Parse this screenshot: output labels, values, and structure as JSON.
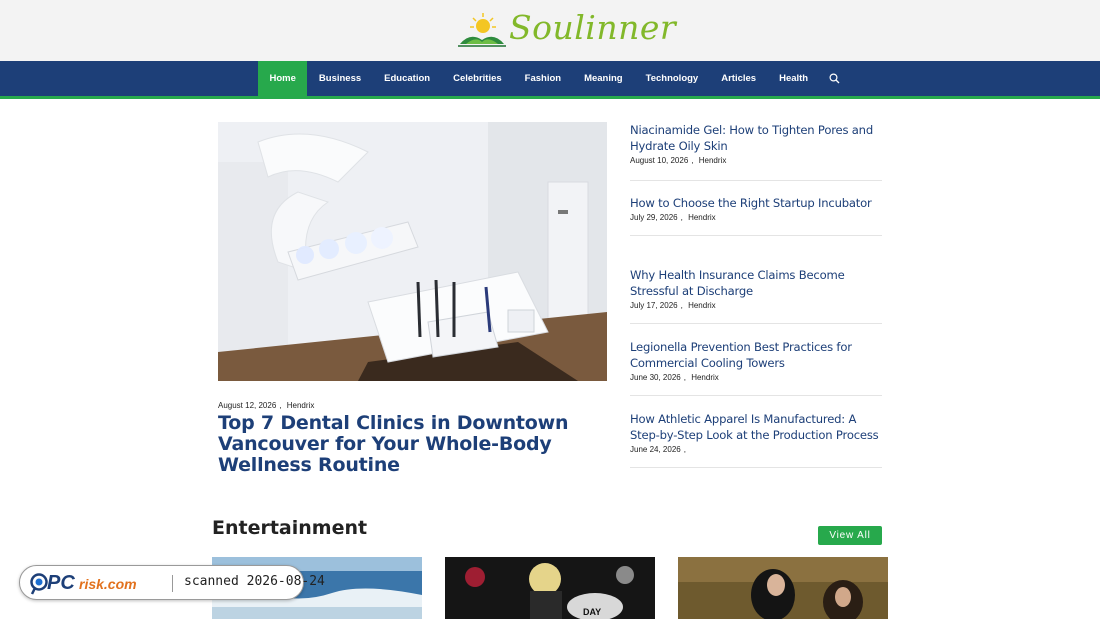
{
  "site": {
    "logo_text": "Soulinner",
    "brand_color": "#82b82a"
  },
  "nav": {
    "items": [
      {
        "label": "Home",
        "active": true
      },
      {
        "label": "Business",
        "active": false
      },
      {
        "label": "Education",
        "active": false
      },
      {
        "label": "Celebrities",
        "active": false
      },
      {
        "label": "Fashion",
        "active": false
      },
      {
        "label": "Meaning",
        "active": false
      },
      {
        "label": "Technology",
        "active": false
      },
      {
        "label": "Articles",
        "active": false
      },
      {
        "label": "Health",
        "active": false
      }
    ],
    "search_icon": "search-icon",
    "bar_color": "#1d3f78",
    "accent_color": "#27a94c"
  },
  "hero": {
    "date": "August 12, 2026",
    "author": "Hendrix",
    "title": "Top 7 Dental Clinics in Downtown Vancouver for Your Whole-Body Wellness Routine"
  },
  "side_posts": [
    {
      "title": "Niacinamide Gel: How to Tighten Pores and Hydrate Oily Skin",
      "date": "August 10, 2026",
      "author": "Hendrix"
    },
    {
      "title": "How to Choose the Right Startup Incubator",
      "date": "July 29, 2026",
      "author": "Hendrix"
    },
    {
      "title": "Why Health Insurance Claims Become Stressful at Discharge",
      "date": "July 17, 2026",
      "author": "Hendrix"
    },
    {
      "title": "Legionella Prevention Best Practices for Commercial Cooling Towers",
      "date": "June 30, 2026",
      "author": "Hendrix"
    },
    {
      "title": "How Athletic Apparel Is Manufactured: A Step-by-Step Look at the Production Process",
      "date": "June 24, 2026",
      "author": ""
    }
  ],
  "entertainment": {
    "heading": "Entertainment",
    "view_all": "View All"
  },
  "watermark": {
    "logo_text": "PCrisk.com",
    "scan_label": "scanned 2026-08-24"
  }
}
